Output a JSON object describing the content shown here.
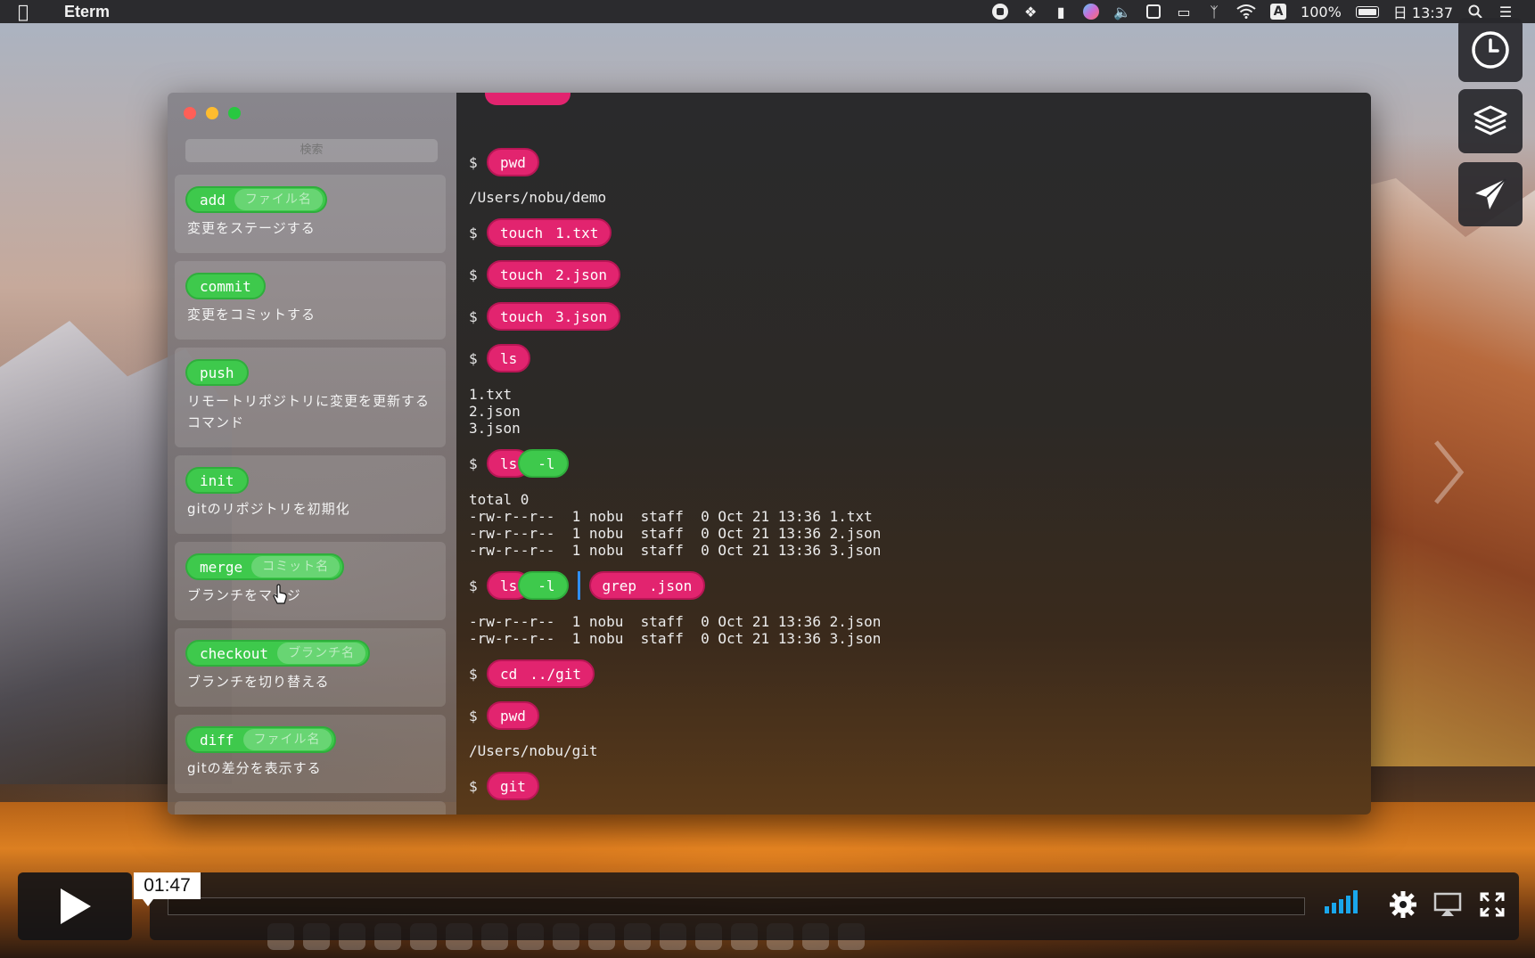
{
  "menubar": {
    "app_name": "Eterm",
    "battery": "100%",
    "clock": "日 13:37",
    "input_source": "A"
  },
  "sidebar": {
    "search_placeholder": "検索",
    "commands": [
      {
        "cmd": "add",
        "arg": "ファイル名",
        "desc": "変更をステージする"
      },
      {
        "cmd": "commit",
        "arg": "",
        "desc": "変更をコミットする"
      },
      {
        "cmd": "push",
        "arg": "",
        "desc": "リモートリポジトリに変更を更新する\nコマンド"
      },
      {
        "cmd": "init",
        "arg": "",
        "desc": "gitのリポジトリを初期化"
      },
      {
        "cmd": "merge",
        "arg": "コミット名",
        "desc": "ブランチをマージ"
      },
      {
        "cmd": "checkout",
        "arg": "ブランチ名",
        "desc": "ブランチを切り替える"
      },
      {
        "cmd": "diff",
        "arg": "ファイル名",
        "desc": "gitの差分を表示する"
      }
    ]
  },
  "terminal": {
    "prompt": "$",
    "entries": [
      {
        "cmd": "pwd"
      },
      {
        "output": "/Users/nobu/demo"
      },
      {
        "cmd": "touch",
        "arg": "1.txt"
      },
      {
        "cmd": "touch",
        "arg": "2.json"
      },
      {
        "cmd": "touch",
        "arg": "3.json"
      },
      {
        "cmd": "ls"
      },
      {
        "output": "1.txt\n2.json\n3.json"
      },
      {
        "cmd": "ls",
        "flag": "-l"
      },
      {
        "output": "total 0\n-rw-r--r--  1 nobu  staff  0 Oct 21 13:36 1.txt\n-rw-r--r--  1 nobu  staff  0 Oct 21 13:36 2.json\n-rw-r--r--  1 nobu  staff  0 Oct 21 13:36 3.json"
      },
      {
        "cmd": "ls",
        "flag": "-l",
        "pipe": {
          "cmd": "grep",
          "arg": ".json"
        }
      },
      {
        "output": "-rw-r--r--  1 nobu  staff  0 Oct 21 13:36 2.json\n-rw-r--r--  1 nobu  staff  0 Oct 21 13:36 3.json"
      },
      {
        "cmd": "cd",
        "arg": "../git"
      },
      {
        "cmd": "pwd"
      },
      {
        "output": "/Users/nobu/git"
      },
      {
        "cmd": "git"
      }
    ]
  },
  "player": {
    "current_time": "01:47",
    "progress": 0.0
  },
  "colors": {
    "command_pill": "#e2246f",
    "option_pill": "#3ec94c",
    "pipe_bar": "#2f8ef5",
    "volume": "#1aa7ec"
  }
}
